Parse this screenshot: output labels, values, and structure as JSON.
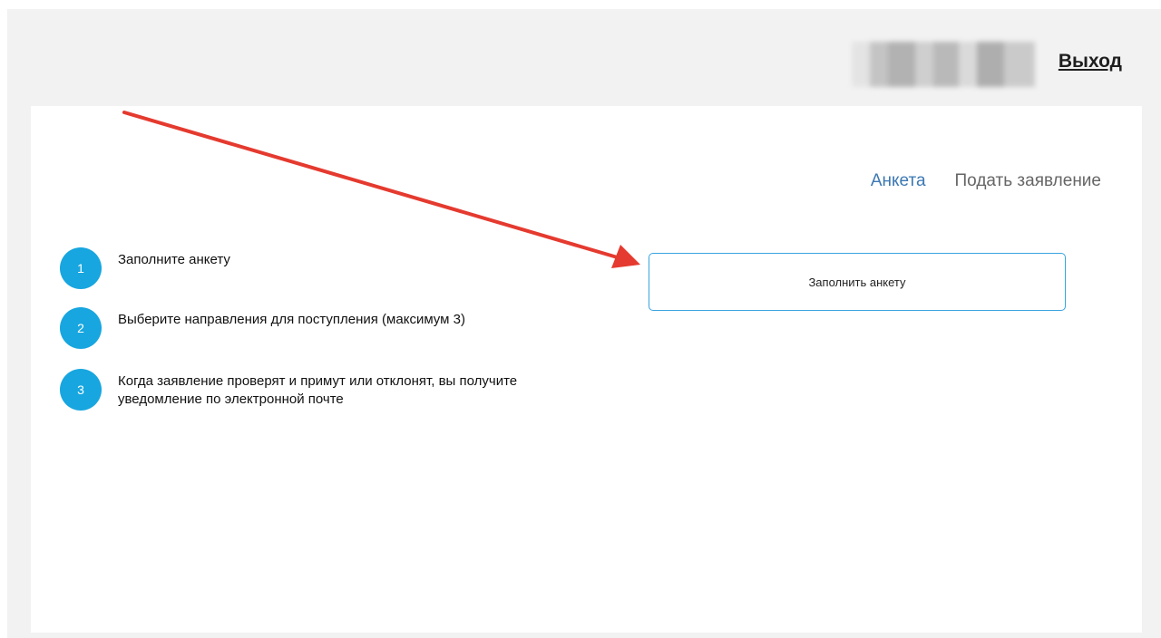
{
  "header": {
    "logout_label": "Выход"
  },
  "nav": {
    "items": [
      {
        "label": "Анкета"
      },
      {
        "label": "Подать заявление"
      }
    ]
  },
  "steps": [
    {
      "number": "1",
      "text": "Заполните анкету"
    },
    {
      "number": "2",
      "text": "Выберите направления для поступления (максимум 3)"
    },
    {
      "number": "3",
      "text": "Когда заявление проверят и примут или отклонят, вы получите уведомление по электронной почте"
    }
  ],
  "main": {
    "fill_button_label": "Заполнить анкету"
  },
  "colors": {
    "accent": "#17a6df",
    "nav_active": "#3c78b4",
    "annotation_arrow": "#e53a2f"
  }
}
